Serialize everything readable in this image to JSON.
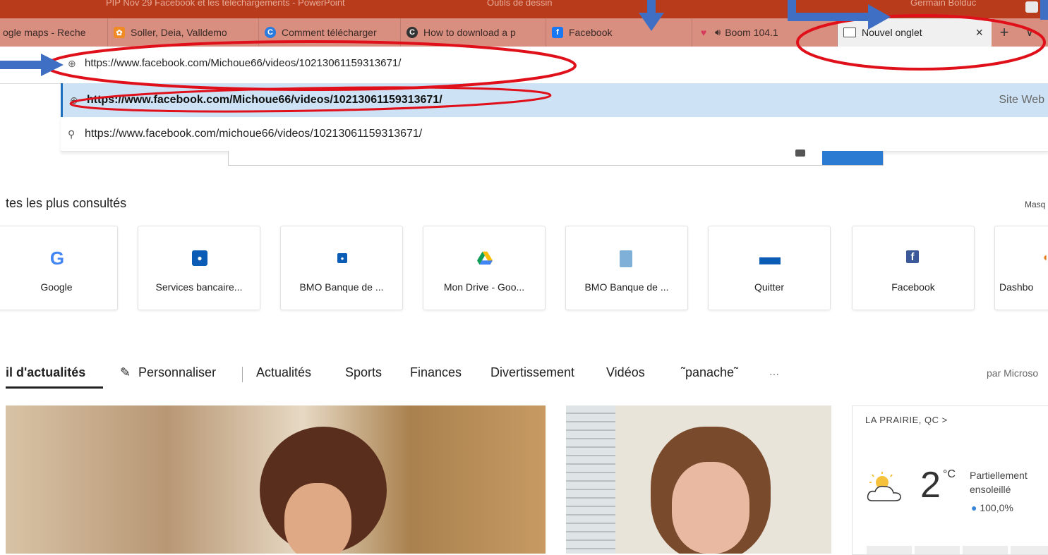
{
  "titlebar": {
    "doc_title": "PIP Nov 29 Facebook et les téléchargements - PowerPoint",
    "context_tab": "Outils de dessin",
    "user": "Germain Bolduc"
  },
  "tabs": [
    {
      "label": "ogle maps - Reche"
    },
    {
      "label": "Soller, Deia, Valldemo"
    },
    {
      "label": "Comment télécharger"
    },
    {
      "label": "How to download a p"
    },
    {
      "label": "Facebook"
    },
    {
      "label": "Boom 104.1"
    },
    {
      "label": "Nouvel onglet"
    }
  ],
  "address": {
    "url": "https://www.facebook.com/Michoue66/videos/10213061159313671/"
  },
  "suggestions": [
    {
      "text": "https://www.facebook.com/Michoue66/videos/10213061159313671/",
      "type": "Site Web"
    },
    {
      "text": "https://www.facebook.com/michoue66/videos/10213061159313671/"
    }
  ],
  "top_sites": {
    "title": "tes les plus consultés",
    "hide_label": "Masq",
    "tiles": [
      {
        "label": "Google"
      },
      {
        "label": "Services bancaire..."
      },
      {
        "label": "BMO Banque de ..."
      },
      {
        "label": "Mon Drive - Goo..."
      },
      {
        "label": "BMO Banque de ..."
      },
      {
        "label": "Quitter"
      },
      {
        "label": "Facebook"
      },
      {
        "label": "Dashbo"
      }
    ]
  },
  "news": {
    "feed": "il d'actualités",
    "customize": "Personnaliser",
    "categories": [
      "Actualités",
      "Sports",
      "Finances",
      "Divertissement",
      "Vidéos",
      "˜panache˜"
    ],
    "more": "···",
    "by": "par Microso"
  },
  "weather": {
    "location": "LA PRAIRIE, QC",
    "temp": "2",
    "unit": "°C",
    "condition": "Partiellement ensoleillé",
    "humidity": "100,0%"
  },
  "colors": {
    "titlebar": "#b83c1c",
    "tabstrip": "#d98f80",
    "suggestion_highlight": "#cde3f5",
    "annotation_red": "#e0101a",
    "annotation_arrow": "#3f6fc4"
  }
}
